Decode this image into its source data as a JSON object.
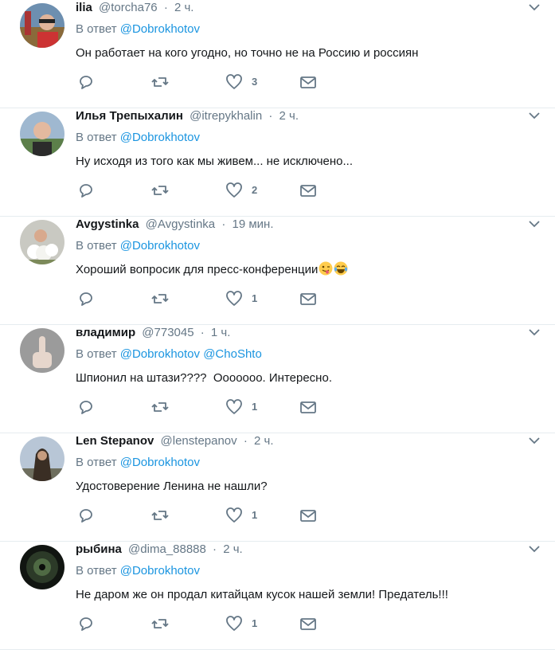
{
  "reply_prefix": "В ответ",
  "tweets": [
    {
      "name": "ilia",
      "handle": "@torcha76",
      "dot": "·",
      "time": "2 ч.",
      "mentions": [
        "@Dobrokhotov"
      ],
      "text": "Он работает на кого угодно, но точно не на Россию и россиян",
      "likes": "3"
    },
    {
      "name": "Илья Трепыхалин",
      "handle": "@itrepykhalin",
      "dot": "·",
      "time": "2 ч.",
      "mentions": [
        "@Dobrokhotov"
      ],
      "text": "Ну исходя из того как мы живем... не исключено...",
      "likes": "2"
    },
    {
      "name": "Avgystinka",
      "handle": "@Avgystinka",
      "dot": "·",
      "time": "19 мин.",
      "mentions": [
        "@Dobrokhotov"
      ],
      "text": "Хороший вопросик для пресс-конференции",
      "likes": "1",
      "emojis": [
        "winking-tongue-emoji",
        "tears-of-joy-emoji"
      ]
    },
    {
      "name": "владимир",
      "handle": "@773045",
      "dot": "·",
      "time": "1 ч.",
      "mentions": [
        "@Dobrokhotov",
        "@ChoShto"
      ],
      "text": "Шпионил на штази????  Ооооооо. Интересно.",
      "likes": "1"
    },
    {
      "name": "Len Stepanov",
      "handle": "@lenstepanov",
      "dot": "·",
      "time": "2 ч.",
      "mentions": [
        "@Dobrokhotov"
      ],
      "text": "Удостоверение Ленина не нашли?",
      "likes": "1"
    },
    {
      "name": "рыбина",
      "handle": "@dima_88888",
      "dot": "·",
      "time": "2 ч.",
      "mentions": [
        "@Dobrokhotov"
      ],
      "text": "Не даром же он продал китайцам кусок нашей земли! Предатель!!!",
      "likes": "1"
    }
  ],
  "icons": {
    "reply": "reply-icon",
    "retweet": "retweet-icon",
    "like": "heart-icon",
    "dm": "envelope-icon",
    "caret": "chevron-down-icon"
  },
  "colors": {
    "text": "#14171a",
    "muted": "#657786",
    "link": "#1b95e0",
    "divider": "#e6ecf0"
  }
}
